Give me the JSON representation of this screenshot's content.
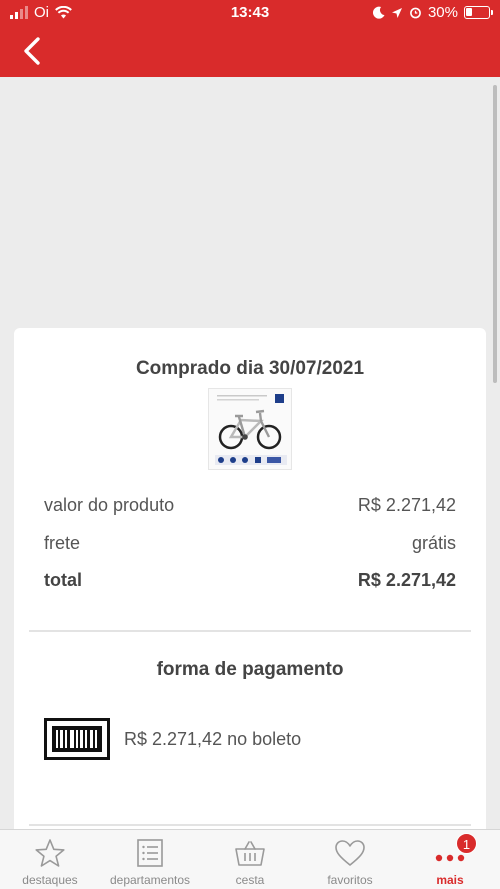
{
  "status_bar": {
    "carrier": "Oi",
    "time": "13:43",
    "battery_text": "30%",
    "battery_level": 0.3
  },
  "order": {
    "title": "Comprado dia 30/07/2021",
    "rows": [
      {
        "label": "valor do produto",
        "value": "R$ 2.271,42"
      },
      {
        "label": "frete",
        "value": "grátis"
      },
      {
        "label": "total",
        "value": "R$ 2.271,42"
      }
    ]
  },
  "payment": {
    "title": "forma de pagamento",
    "text": "R$ 2.271,42 no boleto"
  },
  "bottom_nav": {
    "items": [
      {
        "label": "destaques",
        "icon": "star-icon"
      },
      {
        "label": "departamentos",
        "icon": "list-icon"
      },
      {
        "label": "cesta",
        "icon": "basket-icon"
      },
      {
        "label": "favoritos",
        "icon": "heart-icon"
      },
      {
        "label": "mais",
        "icon": "more-icon",
        "badge": "1"
      }
    ]
  },
  "colors": {
    "brand": "#d92b2b",
    "background": "#ececec"
  }
}
